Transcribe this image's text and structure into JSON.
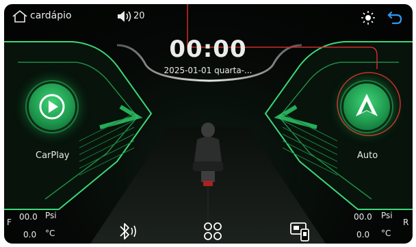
{
  "topbar": {
    "menu_label": "cardápio",
    "volume": "20"
  },
  "clock": {
    "time": "00:00",
    "date": "2025-01-01 quarta-..."
  },
  "apps": {
    "left_label": "CarPlay",
    "right_label": "Auto"
  },
  "tpms_left": {
    "side": "F",
    "pressure": "00.0",
    "pressure_unit": "Psi",
    "temp": "0.0",
    "temp_unit": "°C"
  },
  "tpms_right": {
    "side": "R",
    "pressure": "00.0",
    "pressure_unit": "Psi",
    "temp": "0.0",
    "temp_unit": "°C"
  },
  "colors": {
    "accent_green": "#2fd36d",
    "highlight_red": "#d42a2a",
    "back_blue": "#2f9bf2"
  },
  "icons": {
    "home": "home-icon",
    "volume": "speaker-icon",
    "brightness": "sun-icon",
    "back": "back-arrow-icon",
    "carplay": "play-icon",
    "android_auto": "android-auto-icon",
    "bluetooth": "bluetooth-icon",
    "apps": "apps-grid-icon",
    "mirror": "phone-mirror-icon"
  }
}
